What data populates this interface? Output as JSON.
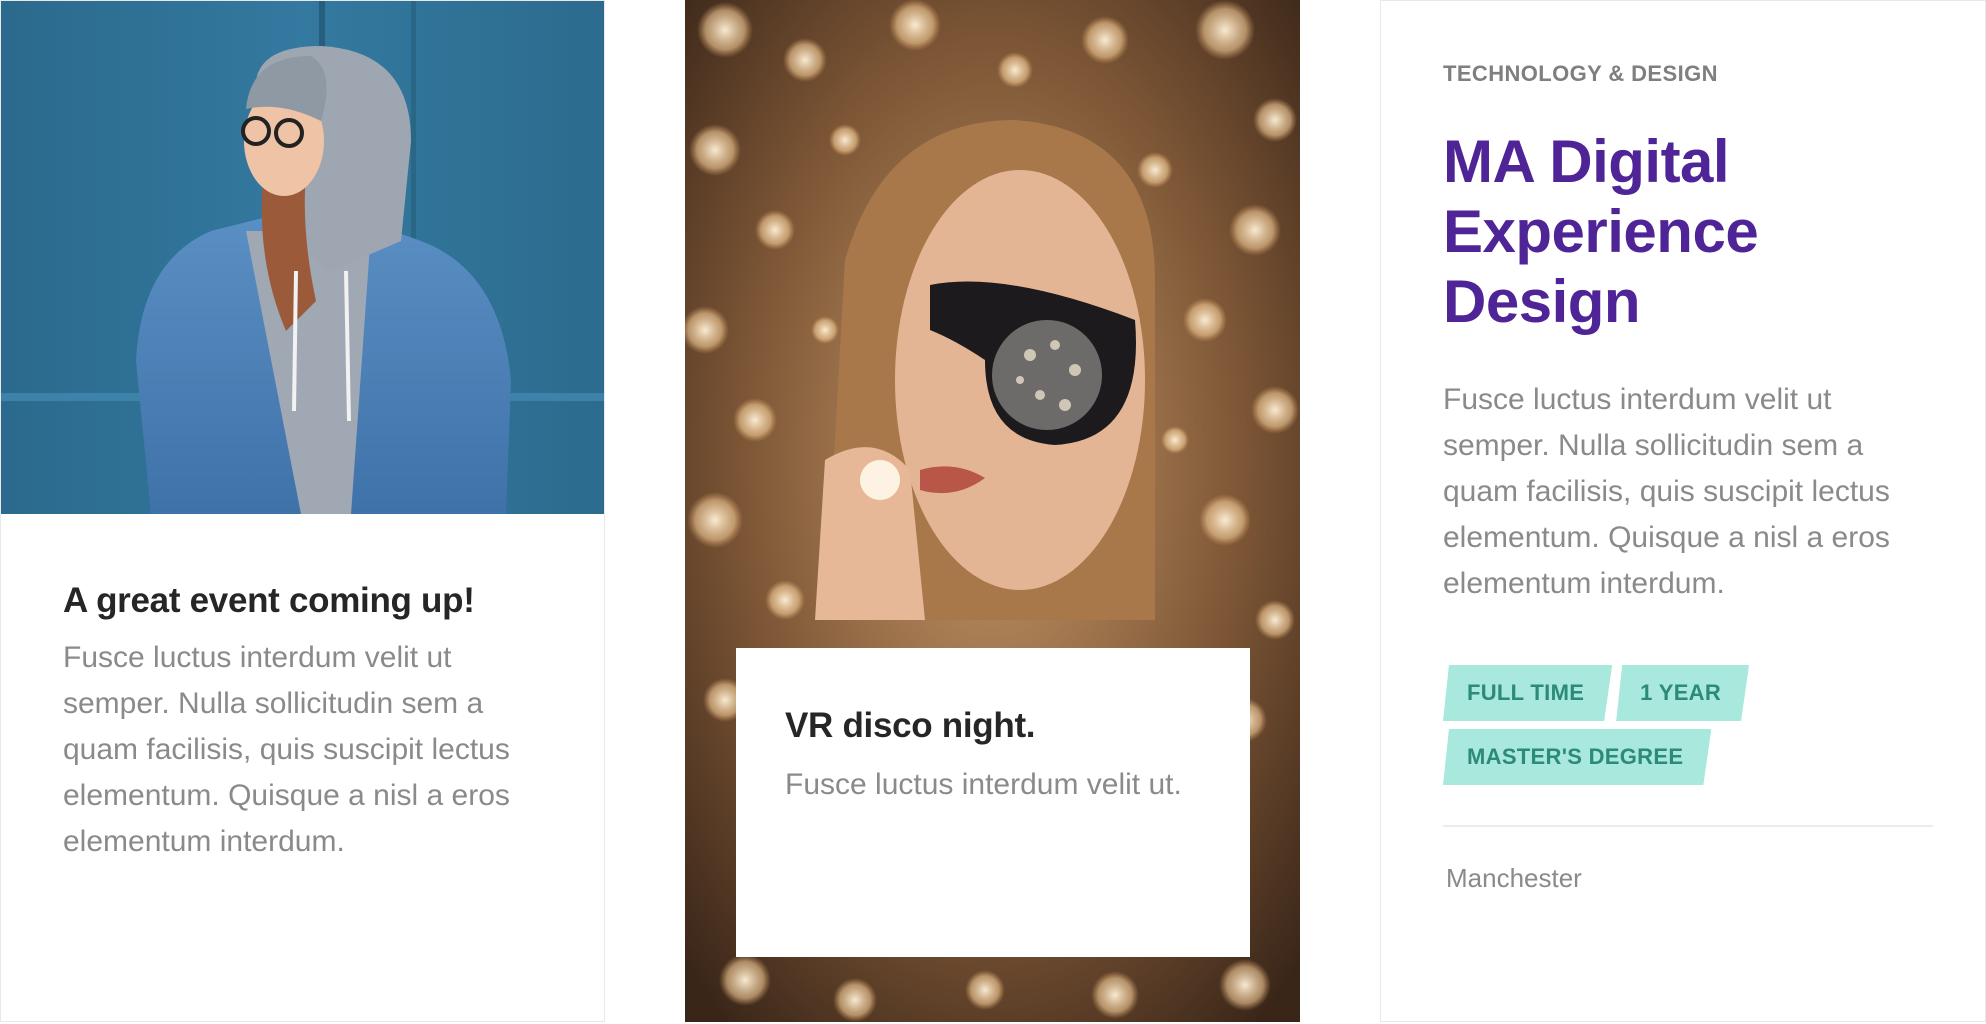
{
  "cards": {
    "event": {
      "title": "A great event coming up!",
      "text": "Fusce luctus interdum velit ut semper. Nulla sollicitudin sem a quam facilisis, quis suscipit lectus elementum. Quisque a nisl a eros elementum interdum."
    },
    "disco": {
      "title": "VR disco night.",
      "text": "Fusce luctus interdum velit ut."
    },
    "course": {
      "category": "TECHNOLOGY & DESIGN",
      "title": "MA Digital Experience Design",
      "text": "Fusce luctus interdum velit ut semper. Nulla sollicitudin sem a quam facilisis, quis suscipit lectus elementum. Quisque a nisl a eros elementum interdum.",
      "tags": [
        "FULL TIME",
        "1 YEAR",
        "MASTER'S DEGREE"
      ],
      "location": "Manchester"
    }
  },
  "colors": {
    "course_title": "#4f2497",
    "tag_background": "#a9e8dc",
    "tag_text": "#2c8a78",
    "body_text": "#8a8a8a",
    "heading_text": "#262626"
  },
  "images": {
    "event_photo": "woman-in-denim-jacket-and-hoodie-photo",
    "disco_photo": "woman-with-sunglasses-and-bokeh-lights-photo"
  }
}
